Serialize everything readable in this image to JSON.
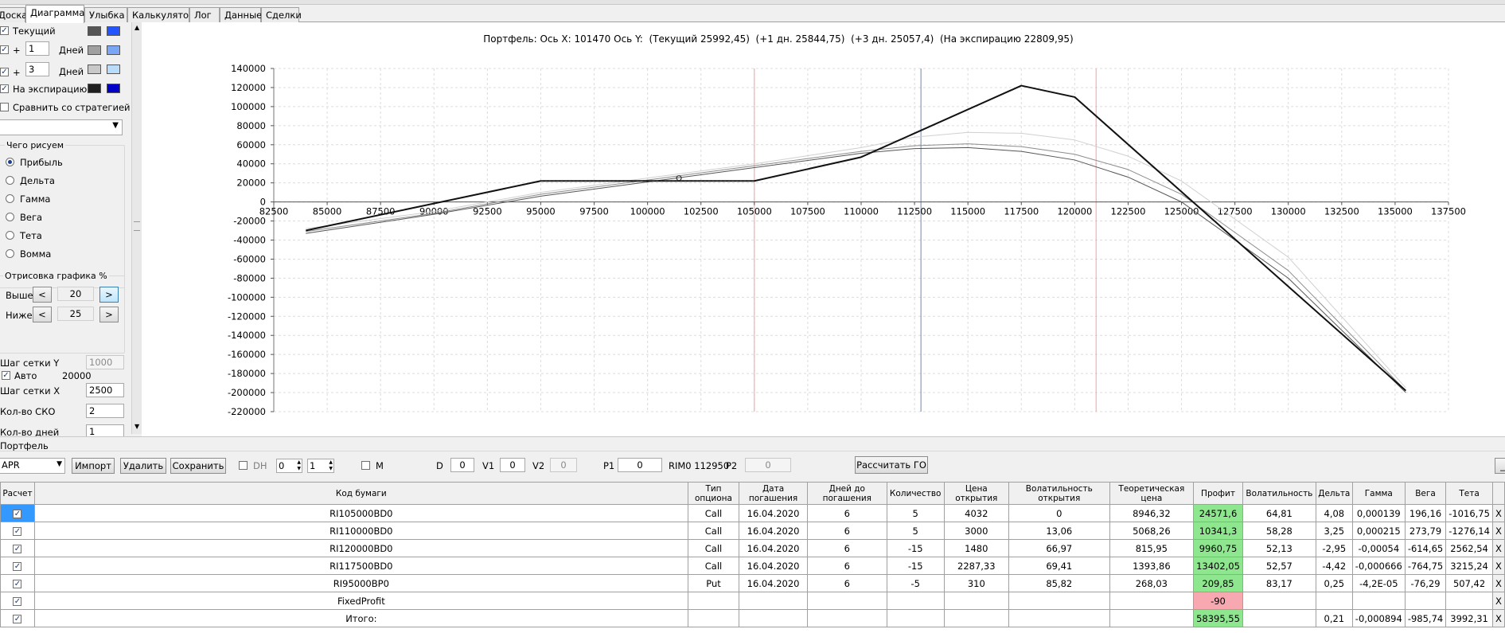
{
  "tabs": [
    {
      "label": "Доска"
    },
    {
      "label": "Диаграмма"
    },
    {
      "label": "Улыбка"
    },
    {
      "label": "Калькулятор"
    },
    {
      "label": "Лог"
    },
    {
      "label": "Данные"
    },
    {
      "label": "Сделки"
    }
  ],
  "left_panel": {
    "current_label": "Текущий",
    "plus1": {
      "sign": "+",
      "value": "1",
      "unit": "Дней"
    },
    "plus3": {
      "sign": "+",
      "value": "3",
      "unit": "Дней"
    },
    "expiry_label": "На экспирацию",
    "compare_label": "Сравнить со стратегией",
    "colors": {
      "current": [
        "#555555",
        "#2255ff"
      ],
      "plus1": [
        "#a0a0a0",
        "#7aa7f5"
      ],
      "plus3": [
        "#c8c8c8",
        "#b9dcfa"
      ],
      "expiry": [
        "#202020",
        "#0000c8"
      ]
    },
    "what_group": "Чего рисуем",
    "radios": [
      "Прибыль",
      "Дельта",
      "Гамма",
      "Вега",
      "Тета",
      "Вомма"
    ],
    "draw_group": "Отрисовка графика %",
    "above_label": "Выше",
    "above_value": "20",
    "below_label": "Ниже",
    "below_value": "25",
    "btn_left": "<",
    "btn_right": ">",
    "grid_y_label": "Шаг сетки Y",
    "grid_y_value": "1000",
    "auto_label": "Авто",
    "auto_value": "20000",
    "grid_x_label": "Шаг сетки X",
    "grid_x_value": "2500",
    "sko_label": "Кол-во СКО",
    "sko_value": "2",
    "days_label": "Кол-во дней",
    "days_value": "1"
  },
  "chart": {
    "title_parts": [
      "Портфель:",
      "Ось X:",
      "101470",
      "Ось Y:",
      "(Текущий 25992,45)",
      "(+1 дн. 25844,75)",
      "(+3 дн. 25057,4)",
      "(На экспирацию 22809,95)"
    ]
  },
  "chart_data": {
    "type": "line",
    "xlim": [
      82500,
      137500
    ],
    "ylim": [
      -220000,
      140000
    ],
    "x_ticks": [
      82500,
      85000,
      87500,
      90000,
      92500,
      95000,
      97500,
      100000,
      102500,
      105000,
      107500,
      110000,
      112500,
      115000,
      117500,
      120000,
      122500,
      125000,
      127500,
      130000,
      132500,
      135000,
      137500
    ],
    "y_ticks": [
      140000,
      120000,
      100000,
      80000,
      60000,
      40000,
      20000,
      0,
      -20000,
      -40000,
      -60000,
      -80000,
      -100000,
      -120000,
      -140000,
      -160000,
      -180000,
      -200000,
      -220000
    ],
    "grid": true,
    "vertical_lines": [
      {
        "x": 105000,
        "color": "#f4a0a0"
      },
      {
        "x": 112800,
        "color": "#6b87b0"
      },
      {
        "x": 121000,
        "color": "#f4a0a0"
      }
    ],
    "marker": {
      "x": 101470,
      "y": 25000
    },
    "series": [
      {
        "color": "#111111",
        "width": 2,
        "x": [
          84000,
          95000,
          105000,
          110000,
          117500,
          120000,
          135500
        ],
        "y": [
          -30000,
          22000,
          22000,
          47000,
          122000,
          110000,
          -198000
        ]
      },
      {
        "color": "#555555",
        "width": 1,
        "x": [
          84000,
          90000,
          95000,
          100000,
          105000,
          110000,
          112500,
          115000,
          117500,
          120000,
          122500,
          125000,
          130000,
          135500
        ],
        "y": [
          -33000,
          -13000,
          6000,
          21000,
          36000,
          51000,
          56000,
          57000,
          53000,
          44000,
          26000,
          0,
          -80000,
          -200000
        ]
      },
      {
        "color": "#8c8c8c",
        "width": 1,
        "x": [
          84000,
          90000,
          95000,
          100000,
          105000,
          110000,
          112500,
          115000,
          117500,
          120000,
          122500,
          125000,
          130000,
          135500
        ],
        "y": [
          -31000,
          -12000,
          8000,
          23000,
          38000,
          53000,
          59000,
          61000,
          58000,
          50000,
          34000,
          8000,
          -72000,
          -198000
        ]
      },
      {
        "color": "#d0d0d0",
        "width": 1,
        "x": [
          84000,
          90000,
          95000,
          100000,
          105000,
          110000,
          112500,
          115000,
          117500,
          120000,
          122500,
          125000,
          130000,
          135500
        ],
        "y": [
          -28000,
          -10000,
          10000,
          25000,
          40000,
          57000,
          68000,
          73000,
          72000,
          65000,
          48000,
          22000,
          -58000,
          -195000
        ]
      }
    ]
  },
  "portfolio_label": "Портфель",
  "toolbar": {
    "portfolio_select": "APR",
    "import": "Импорт",
    "delete": "Удалить",
    "save": "Сохранить",
    "dh": "DH",
    "spin1": "0",
    "spin2": "1",
    "m": "M",
    "d_label": "D",
    "d_value": "0",
    "v1_label": "V1",
    "v1_value": "0",
    "v2_label": "V2",
    "v2_value": "0",
    "p1_label": "P1",
    "p1_value": "0",
    "rim": "RIM0 112950",
    "p2_label": "P2",
    "p2_value": "0",
    "calc_go": "Рассчитать ГО"
  },
  "table": {
    "headers": [
      "Расчет",
      "Код бумаги",
      "Тип опциона",
      "Дата погашения",
      "Дней до погашения",
      "Количество",
      "Цена открытия",
      "Волатильность открытия",
      "Теоретическая цена",
      "Профит",
      "Волатильность",
      "Дельта",
      "Гамма",
      "Вега",
      "Тета",
      ""
    ],
    "rows": [
      {
        "check": true,
        "code": "RI105000BD0",
        "type": "Call",
        "date": "16.04.2020",
        "days": "6",
        "qty": "5",
        "open": "4032",
        "vol_open": "0",
        "theo": "8946,32",
        "profit": "24571,6",
        "profit_color": "green",
        "vol": "64,81",
        "delta": "4,08",
        "gamma": "0,000139",
        "vega": "196,16",
        "theta": "-1016,75",
        "x": "X"
      },
      {
        "check": true,
        "code": "RI110000BD0",
        "type": "Call",
        "date": "16.04.2020",
        "days": "6",
        "qty": "5",
        "open": "3000",
        "vol_open": "13,06",
        "theo": "5068,26",
        "profit": "10341,3",
        "profit_color": "green",
        "vol": "58,28",
        "delta": "3,25",
        "gamma": "0,000215",
        "vega": "273,79",
        "theta": "-1276,14",
        "x": "X"
      },
      {
        "check": true,
        "code": "RI120000BD0",
        "type": "Call",
        "date": "16.04.2020",
        "days": "6",
        "qty": "-15",
        "open": "1480",
        "vol_open": "66,97",
        "theo": "815,95",
        "profit": "9960,75",
        "profit_color": "green",
        "vol": "52,13",
        "delta": "-2,95",
        "gamma": "-0,00054",
        "vega": "-614,65",
        "theta": "2562,54",
        "x": "X"
      },
      {
        "check": true,
        "code": "RI117500BD0",
        "type": "Call",
        "date": "16.04.2020",
        "days": "6",
        "qty": "-15",
        "open": "2287,33",
        "vol_open": "69,41",
        "theo": "1393,86",
        "profit": "13402,05",
        "profit_color": "green",
        "vol": "52,57",
        "delta": "-4,42",
        "gamma": "-0,000666",
        "vega": "-764,75",
        "theta": "3215,24",
        "x": "X"
      },
      {
        "check": true,
        "code": "RI95000BP0",
        "type": "Put",
        "date": "16.04.2020",
        "days": "6",
        "qty": "-5",
        "open": "310",
        "vol_open": "85,82",
        "theo": "268,03",
        "profit": "209,85",
        "profit_color": "green",
        "vol": "83,17",
        "delta": "0,25",
        "gamma": "-4,2E-05",
        "vega": "-76,29",
        "theta": "507,42",
        "x": "X"
      },
      {
        "check": true,
        "code": "FixedProfit",
        "type": "",
        "date": "",
        "days": "",
        "qty": "",
        "open": "",
        "vol_open": "",
        "theo": "",
        "profit": "-90",
        "profit_color": "pink",
        "vol": "",
        "delta": "",
        "gamma": "",
        "vega": "",
        "theta": "",
        "x": "X"
      },
      {
        "check": true,
        "code": "Итого:",
        "type": "",
        "date": "",
        "days": "",
        "qty": "",
        "open": "",
        "vol_open": "",
        "theo": "",
        "profit": "58395,55",
        "profit_color": "green",
        "vol": "",
        "delta": "0,21",
        "gamma": "-0,000894",
        "vega": "-985,74",
        "theta": "3992,31",
        "x": "X"
      }
    ]
  }
}
